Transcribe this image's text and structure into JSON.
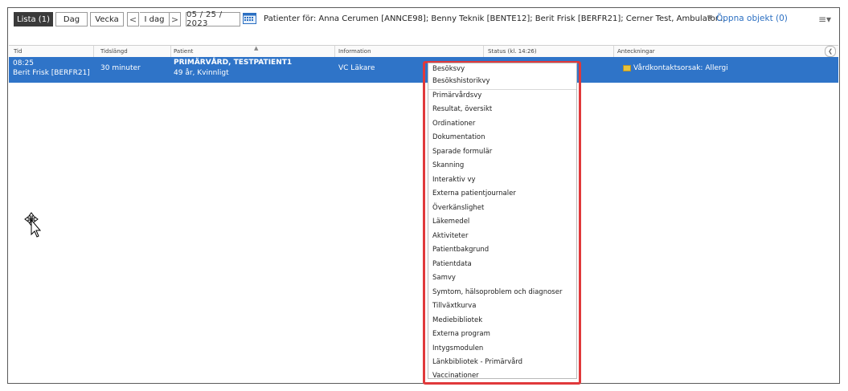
{
  "toolbar": {
    "view_list": "Lista (1)",
    "view_day": "Dag",
    "view_week": "Vecka",
    "nav_prev": "<",
    "today": "I dag",
    "nav_next": ">",
    "date": "05 / 25 / 2023",
    "patients_label": "Patienter för: Anna Cerumen [ANNCE98]; Benny Teknik [BENTE12]; Berit Frisk [BERFR21]; Cerner Test, Ambulator...",
    "open_objects": "Öppna objekt (0)"
  },
  "table": {
    "columns": [
      "Tid",
      "Tidslängd",
      "Patient",
      "Information",
      "Status (kl. 14:26)",
      "Anteckningar"
    ],
    "rows": [
      {
        "time": "08:25",
        "staff": "Berit Frisk [BERFR21]",
        "duration": "30 minuter",
        "patient_name": "PRIMÄRVÅRD, TESTPATIENT1",
        "patient_info": "49 år, Kvinnligt",
        "information": "VC Läkare",
        "note": "Vårdkontaktsorsak: Allergi"
      }
    ]
  },
  "context_menu": {
    "items": [
      "Besöksvy",
      "Besökshistorikvy",
      "Primärvårdsvy",
      "Resultat, översikt",
      "Ordinationer",
      "Dokumentation",
      "Sparade formulär",
      "Skanning",
      "Interaktiv vy",
      "Externa patientjournaler",
      "Överkänslighet",
      "Läkemedel",
      "Aktiviteter",
      "Patientbakgrund",
      "Patientdata",
      "Samvy",
      "Symtom, hälsoproblem och diagnoser",
      "Tillväxtkurva",
      "Mediebibliotek",
      "Externa program",
      "Intygsmodulen",
      "Länkbibliotek - Primärvård",
      "Vaccinationer"
    ]
  },
  "colors": {
    "selected_row": "#2f74c8",
    "highlight_border": "#e0393b",
    "link": "#2b6fc2"
  }
}
